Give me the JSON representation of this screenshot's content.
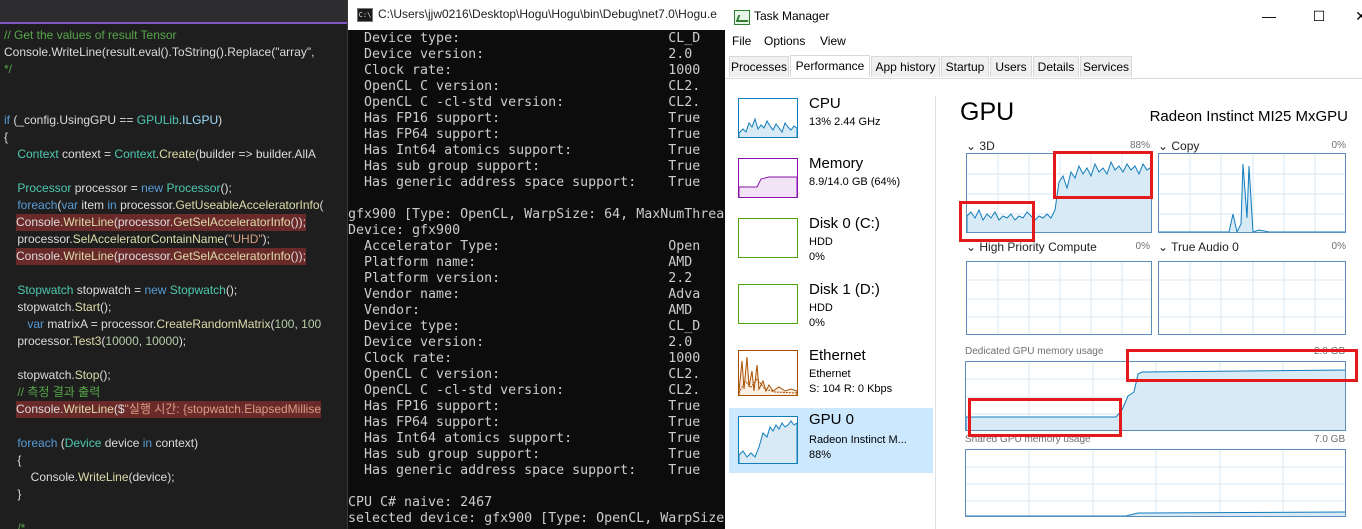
{
  "editor": {
    "lines": [
      [
        [
          "cm",
          "// Get the values of result Tensor"
        ]
      ],
      [
        [
          "pl",
          "Console.WriteLine(result.eval().ToString().Replace(\"array\","
        ]
      ],
      [
        [
          "cm",
          "*/"
        ]
      ],
      [
        [
          "pl",
          ""
        ]
      ],
      [
        [
          "pl",
          ""
        ]
      ],
      [
        [
          "kw",
          "if"
        ],
        [
          "pl",
          " (_config.UsingGPU == "
        ],
        [
          "ty",
          "GPULib"
        ],
        [
          "pl",
          "."
        ],
        [
          "id",
          "ILGPU"
        ],
        [
          "pl",
          ")"
        ]
      ],
      [
        [
          "pl",
          "{"
        ]
      ],
      [
        [
          "pl",
          "    "
        ],
        [
          "ty",
          "Context"
        ],
        [
          "pl",
          " context = "
        ],
        [
          "ty",
          "Context"
        ],
        [
          "pl",
          "."
        ],
        [
          "fn",
          "Create"
        ],
        [
          "pl",
          "(builder => builder.AllA"
        ]
      ],
      [
        [
          "pl",
          ""
        ]
      ],
      [
        [
          "pl",
          "    "
        ],
        [
          "ty",
          "Processor"
        ],
        [
          "pl",
          " processor = "
        ],
        [
          "kw",
          "new"
        ],
        [
          "pl",
          " "
        ],
        [
          "ty",
          "Processor"
        ],
        [
          "pl",
          "();"
        ]
      ],
      [
        [
          "pl",
          "    "
        ],
        [
          "kw",
          "foreach"
        ],
        [
          "pl",
          "("
        ],
        [
          "kw",
          "var"
        ],
        [
          "pl",
          " item "
        ],
        [
          "kw",
          "in"
        ],
        [
          "pl",
          " processor."
        ],
        [
          "fn",
          "GetUseableAcceleratorInfo"
        ],
        [
          "pl",
          "("
        ]
      ],
      [
        [
          "pl",
          "    Console."
        ],
        [
          "fn",
          "WriteLine"
        ],
        [
          "pl",
          "(processor."
        ],
        [
          "fn",
          "GetSelAcceleratorInfo"
        ],
        [
          "pl",
          "());"
        ]
      ],
      [
        [
          "pl",
          "    processor."
        ],
        [
          "fn",
          "SelAcceleratorContainName"
        ],
        [
          "pl",
          "("
        ],
        [
          "st",
          "\"UHD\""
        ],
        [
          "pl",
          ");"
        ]
      ],
      [
        [
          "pl",
          "    Console."
        ],
        [
          "fn",
          "WriteLine"
        ],
        [
          "pl",
          "(processor."
        ],
        [
          "fn",
          "GetSelAcceleratorInfo"
        ],
        [
          "pl",
          "());"
        ]
      ],
      [
        [
          "pl",
          ""
        ]
      ],
      [
        [
          "pl",
          "    "
        ],
        [
          "ty",
          "Stopwatch"
        ],
        [
          "pl",
          " stopwatch = "
        ],
        [
          "kw",
          "new"
        ],
        [
          "pl",
          " "
        ],
        [
          "ty",
          "Stopwatch"
        ],
        [
          "pl",
          "();"
        ]
      ],
      [
        [
          "pl",
          "    stopwatch."
        ],
        [
          "fn",
          "Start"
        ],
        [
          "pl",
          "();"
        ]
      ],
      [
        [
          "pl",
          "       "
        ],
        [
          "kw",
          "var"
        ],
        [
          "pl",
          " matrixA = processor."
        ],
        [
          "fn",
          "CreateRandomMatrix"
        ],
        [
          "pl",
          "("
        ],
        [
          "nu",
          "100"
        ],
        [
          "pl",
          ", "
        ],
        [
          "nu",
          "100"
        ]
      ],
      [
        [
          "pl",
          "    processor."
        ],
        [
          "fn",
          "Test3"
        ],
        [
          "pl",
          "("
        ],
        [
          "nu",
          "10000"
        ],
        [
          "pl",
          ", "
        ],
        [
          "nu",
          "10000"
        ],
        [
          "pl",
          ");"
        ]
      ],
      [
        [
          "pl",
          ""
        ]
      ],
      [
        [
          "pl",
          "    stopwatch."
        ],
        [
          "fn",
          "Stop"
        ],
        [
          "pl",
          "();"
        ]
      ],
      [
        [
          "cm",
          "    // 측정 결과 출력"
        ]
      ],
      [
        [
          "pl",
          "    Console."
        ],
        [
          "fn",
          "WriteLine"
        ],
        [
          "pl",
          "($"
        ],
        [
          "st",
          "\"실행 시간: {stopwatch.ElapsedMillise"
        ]
      ],
      [
        [
          "pl",
          ""
        ]
      ],
      [
        [
          "pl",
          "    "
        ],
        [
          "kw",
          "foreach"
        ],
        [
          "pl",
          " ("
        ],
        [
          "ty",
          "Device"
        ],
        [
          "pl",
          " device "
        ],
        [
          "kw",
          "in"
        ],
        [
          "pl",
          " context)"
        ]
      ],
      [
        [
          "pl",
          "    {"
        ]
      ],
      [
        [
          "pl",
          "        Console."
        ],
        [
          "fn",
          "WriteLine"
        ],
        [
          "pl",
          "(device);"
        ]
      ],
      [
        [
          "pl",
          "    }"
        ]
      ],
      [
        [
          "pl",
          ""
        ]
      ],
      [
        [
          "cm",
          "    /*"
        ]
      ]
    ],
    "highlight_rows": [
      11,
      13,
      22
    ]
  },
  "console": {
    "title": "C:\\Users\\jjw0216\\Desktop\\Hogu\\Hogu\\bin\\Debug\\net7.0\\Hogu.e",
    "lines": [
      "  Device type:                          CL_D",
      "  Device version:                       2.0",
      "  Clock rate:                           1000",
      "  OpenCL C version:                     CL2.",
      "  OpenCL C -cl-std version:             CL2.",
      "  Has FP16 support:                     True",
      "  Has FP64 support:                     True",
      "  Has Int64 atomics support:            True",
      "  Has sub group support:                True",
      "  Has generic address space support:    True",
      "",
      "gfx900 [Type: OpenCL, WarpSize: 64, MaxNumThrea",
      "Device: gfx900",
      "  Accelerator Type:                     Open",
      "  Platform name:                        AMD ",
      "  Platform version:                     2.2 ",
      "  Vendor name:                          Adva",
      "  Vendor:                               AMD ",
      "  Device type:                          CL_D",
      "  Device version:                       2.0",
      "  Clock rate:                           1000",
      "  OpenCL C version:                     CL2.",
      "  OpenCL C -cl-std version:             CL2.",
      "  Has FP16 support:                     True",
      "  Has FP64 support:                     True",
      "  Has Int64 atomics support:            True",
      "  Has sub group support:                True",
      "  Has generic address space support:    True",
      "",
      "CPU C# naive: 2467",
      "selected device: gfx900 [Type: OpenCL, WarpSize"
    ]
  },
  "taskmanager": {
    "title": "Task Manager",
    "window_buttons": {
      "minimize": "—",
      "maximize": "☐",
      "close": "✕"
    },
    "menu": [
      "File",
      "Options",
      "View"
    ],
    "tabs": [
      "Processes",
      "Performance",
      "App history",
      "Startup",
      "Users",
      "Details",
      "Services"
    ],
    "active_tab": "Performance",
    "resources": [
      {
        "name": "CPU",
        "sub1": "13% 2.44 GHz",
        "sub2": "",
        "color": "#117dbb"
      },
      {
        "name": "Memory",
        "sub1": "8.9/14.0 GB (64%)",
        "sub2": "",
        "color": "#8b12ae"
      },
      {
        "name": "Disk 0 (C:)",
        "sub1": "HDD",
        "sub2": "0%",
        "color": "#4da60c"
      },
      {
        "name": "Disk 1 (D:)",
        "sub1": "HDD",
        "sub2": "0%",
        "color": "#4da60c"
      },
      {
        "name": "Ethernet",
        "sub1": "Ethernet",
        "sub2": "S: 104  R: 0 Kbps",
        "color": "#a74f01"
      },
      {
        "name": "GPU 0",
        "sub1": "Radeon Instinct M...",
        "sub2": "88%",
        "color": "#117dbb"
      }
    ],
    "selected_resource": "GPU 0",
    "gpu": {
      "heading": "GPU",
      "model": "Radeon Instinct MI25 MxGPU",
      "engines": [
        {
          "label": "3D",
          "pct": "88%"
        },
        {
          "label": "Copy",
          "pct": "0%"
        },
        {
          "label": "High Priority Compute",
          "pct": "0%"
        },
        {
          "label": "True Audio 0",
          "pct": "0%"
        }
      ],
      "dedicated_label": "Dedicated GPU memory usage",
      "dedicated_max": "2.0 GB",
      "shared_label": "Shared GPU memory usage",
      "shared_max": "7.0 GB"
    }
  }
}
